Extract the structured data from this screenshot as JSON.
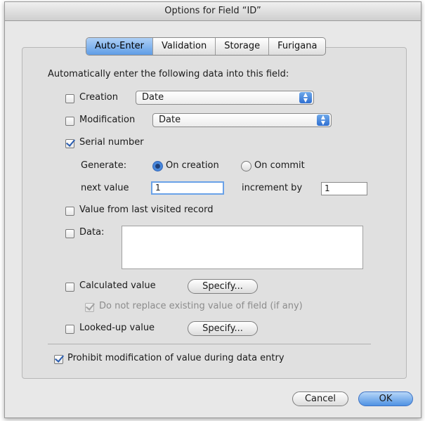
{
  "window": {
    "title": "Options for Field “ID”"
  },
  "tabs": [
    {
      "label": "Auto-Enter",
      "active": true
    },
    {
      "label": "Validation",
      "active": false
    },
    {
      "label": "Storage",
      "active": false
    },
    {
      "label": "Furigana",
      "active": false
    }
  ],
  "auto_enter": {
    "heading": "Automatically enter the following data into this field:",
    "creation": {
      "label": "Creation",
      "checked": false,
      "popup_value": "Date"
    },
    "modification": {
      "label": "Modification",
      "checked": false,
      "popup_value": "Date"
    },
    "serial_number": {
      "label": "Serial number",
      "checked": true,
      "generate_label": "Generate:",
      "on_creation_label": "On creation",
      "on_commit_label": "On commit",
      "selected": "On creation",
      "next_value_label": "next value",
      "next_value": "1",
      "increment_label": "increment by",
      "increment_value": "1"
    },
    "last_visited": {
      "label": "Value from last visited record",
      "checked": false
    },
    "data": {
      "label": "Data:",
      "checked": false,
      "value": ""
    },
    "calculated": {
      "label": "Calculated value",
      "checked": false,
      "specify_label": "Specify...",
      "do_not_replace_label": "Do not replace existing value of field (if any)",
      "do_not_replace_checked": true
    },
    "looked_up": {
      "label": "Looked-up value",
      "checked": false,
      "specify_label": "Specify..."
    },
    "prohibit": {
      "label": "Prohibit modification of value during data entry",
      "checked": true
    }
  },
  "buttons": {
    "cancel_label": "Cancel",
    "ok_label": "OK"
  }
}
